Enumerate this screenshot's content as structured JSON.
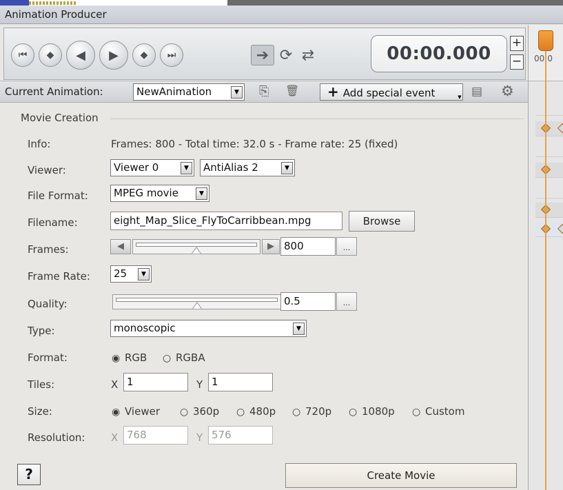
{
  "window": {
    "title": "Animation Producer"
  },
  "toolbar": {
    "icons": [
      "skip-start-icon",
      "prev-key-icon",
      "play-backward-icon",
      "play-forward-icon",
      "next-key-icon",
      "skip-end-icon"
    ],
    "modes": [
      "play-once-mode-icon",
      "loop-mode-icon",
      "swing-mode-icon"
    ],
    "time": "00:00.000",
    "plus": "+",
    "minus": "−"
  },
  "animation_bar": {
    "label": "Current Animation:",
    "current": "NewAnimation",
    "add_special_event": "Add special event"
  },
  "movie": {
    "section_title": "Movie Creation",
    "info_label": "Info:",
    "info_text": "Frames: 800 - Total time: 32.0 s - Frame rate: 25 (fixed)",
    "viewer_label": "Viewer:",
    "viewer_value": "Viewer 0",
    "antialias_value": "AntiAlias 2",
    "format_label": "File Format:",
    "format_value": "MPEG movie",
    "filename_label": "Filename:",
    "filename_value": "eight_Map_Slice_FlyToCarribbean.mpg",
    "browse": "Browse",
    "frames_label": "Frames:",
    "frames_value": "800",
    "frames_slider_fraction": 0.5,
    "framerate_label": "Frame Rate:",
    "framerate_value": "25",
    "quality_label": "Quality:",
    "quality_value": "0.5",
    "quality_slider_fraction": 0.5,
    "dots": "...",
    "type_label": "Type:",
    "type_value": "monoscopic",
    "pixfmt_label": "Format:",
    "pixfmt_options": [
      "RGB",
      "RGBA"
    ],
    "pixfmt_selected": "RGB",
    "tiles_label": "Tiles:",
    "tiles_x": "1",
    "tiles_y": "1",
    "x": "X",
    "y": "Y",
    "size_label": "Size:",
    "size_options": [
      "Viewer",
      "360p",
      "480p",
      "720p",
      "1080p",
      "Custom"
    ],
    "size_selected": "Viewer",
    "resolution_label": "Resolution:",
    "res_x": "768",
    "res_y": "576",
    "help": "?",
    "create": "Create Movie"
  },
  "timeline": {
    "time_label": "00:0"
  }
}
